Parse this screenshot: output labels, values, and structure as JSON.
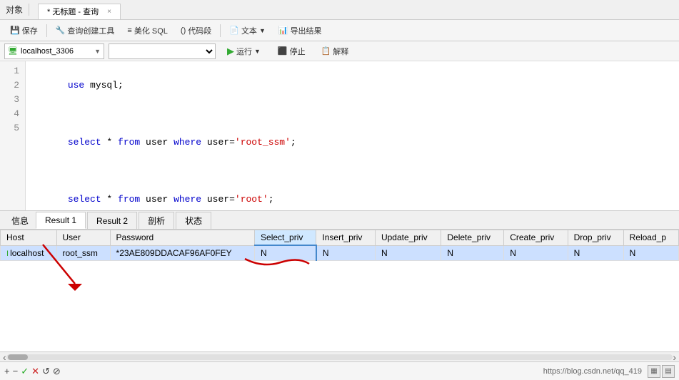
{
  "titleBar": {
    "objectLabel": "对象",
    "tabTitle": "* 无标题 - 查询",
    "closeIcon": "×"
  },
  "toolbar": {
    "save": "保存",
    "queryBuilder": "查询创建工具",
    "beautifySQL": "美化 SQL",
    "codeBlock": "代码段",
    "text": "文本",
    "exportResult": "导出结果"
  },
  "connBar": {
    "connection": "localhost_3306",
    "database": "",
    "run": "运行",
    "stop": "停止",
    "explain": "解释"
  },
  "editor": {
    "lines": [
      {
        "num": 1,
        "code": "use mysql;"
      },
      {
        "num": 2,
        "code": ""
      },
      {
        "num": 3,
        "code": "select * from user where user='root_ssm';"
      },
      {
        "num": 4,
        "code": ""
      },
      {
        "num": 5,
        "code": "select * from user where user='root';"
      }
    ]
  },
  "resultTabs": {
    "infoLabel": "信息",
    "result1": "Result 1",
    "result2": "Result 2",
    "profiling": "剖析",
    "status": "状态"
  },
  "tableHeaders": [
    "Host",
    "User",
    "Password",
    "Select_priv",
    "Insert_priv",
    "Update_priv",
    "Delete_priv",
    "Create_priv",
    "Drop_priv",
    "Reload_p"
  ],
  "tableRows": [
    {
      "indicator": "I",
      "host": "localhost",
      "user": "root_ssm",
      "password": "*23AE809DDACAF96AF0FEY",
      "selectPriv": "N",
      "insertPriv": "N",
      "updatePriv": "N",
      "deletePriv": "N",
      "createPriv": "N",
      "dropPriv": "N",
      "reloadP": "N"
    }
  ],
  "bottomToolbar": {
    "addIcon": "+",
    "removeIcon": "−",
    "checkIcon": "✓",
    "crossIcon": "✕",
    "refreshIcon": "↺",
    "stopIcon": "⊘",
    "url": "https://blog.csdn.net/qq_419",
    "gridIcon1": "▦",
    "gridIcon2": "▤"
  },
  "scrollbar": {
    "leftArrow": "‹",
    "rightArrow": "›"
  }
}
